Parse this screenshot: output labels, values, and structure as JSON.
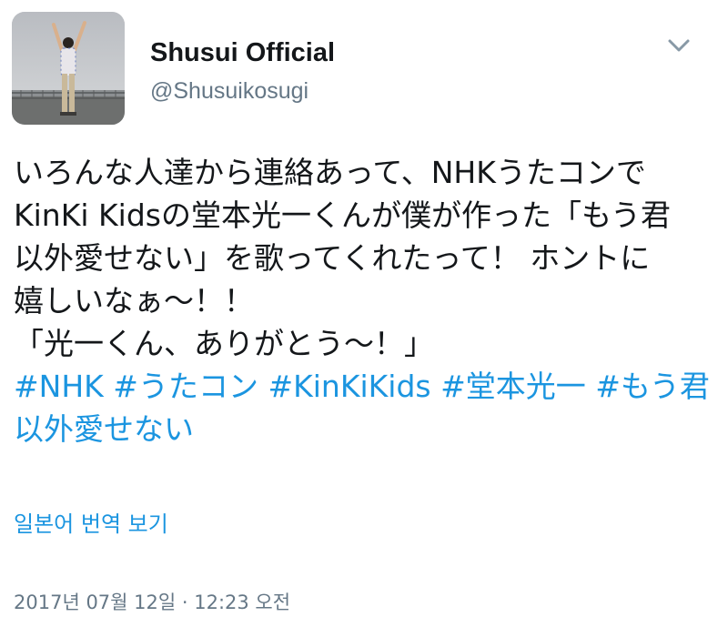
{
  "author": {
    "display_name": "Shusui Official",
    "handle": "@Shusuikosugi",
    "avatar_icon": "user-avatar-photo"
  },
  "menu": {
    "icon": "chevron-down-icon"
  },
  "tweet": {
    "lines": [
      "いろんな人達から連絡あって、NHKうたコンで",
      "KinKi Kidsの堂本光一くんが僕が作った「もう君",
      "以外愛せない」を歌ってくれたって！ ホントに",
      "嬉しいなぁ〜！！",
      "「光一くん、ありがとう〜！」"
    ],
    "hashtag_lines": [
      [
        "#NHK",
        "#うたコン",
        "#KinKiKids",
        "#堂本光一",
        "#もう君"
      ],
      [
        "以外愛せない"
      ]
    ]
  },
  "translate": {
    "label": "일본어 번역 보기"
  },
  "meta": {
    "timestamp": "2017년 07월 12일 · 12:23 오전"
  },
  "colors": {
    "link": "#1b95e0",
    "secondary_text": "#657786",
    "primary_text": "#14171a"
  }
}
